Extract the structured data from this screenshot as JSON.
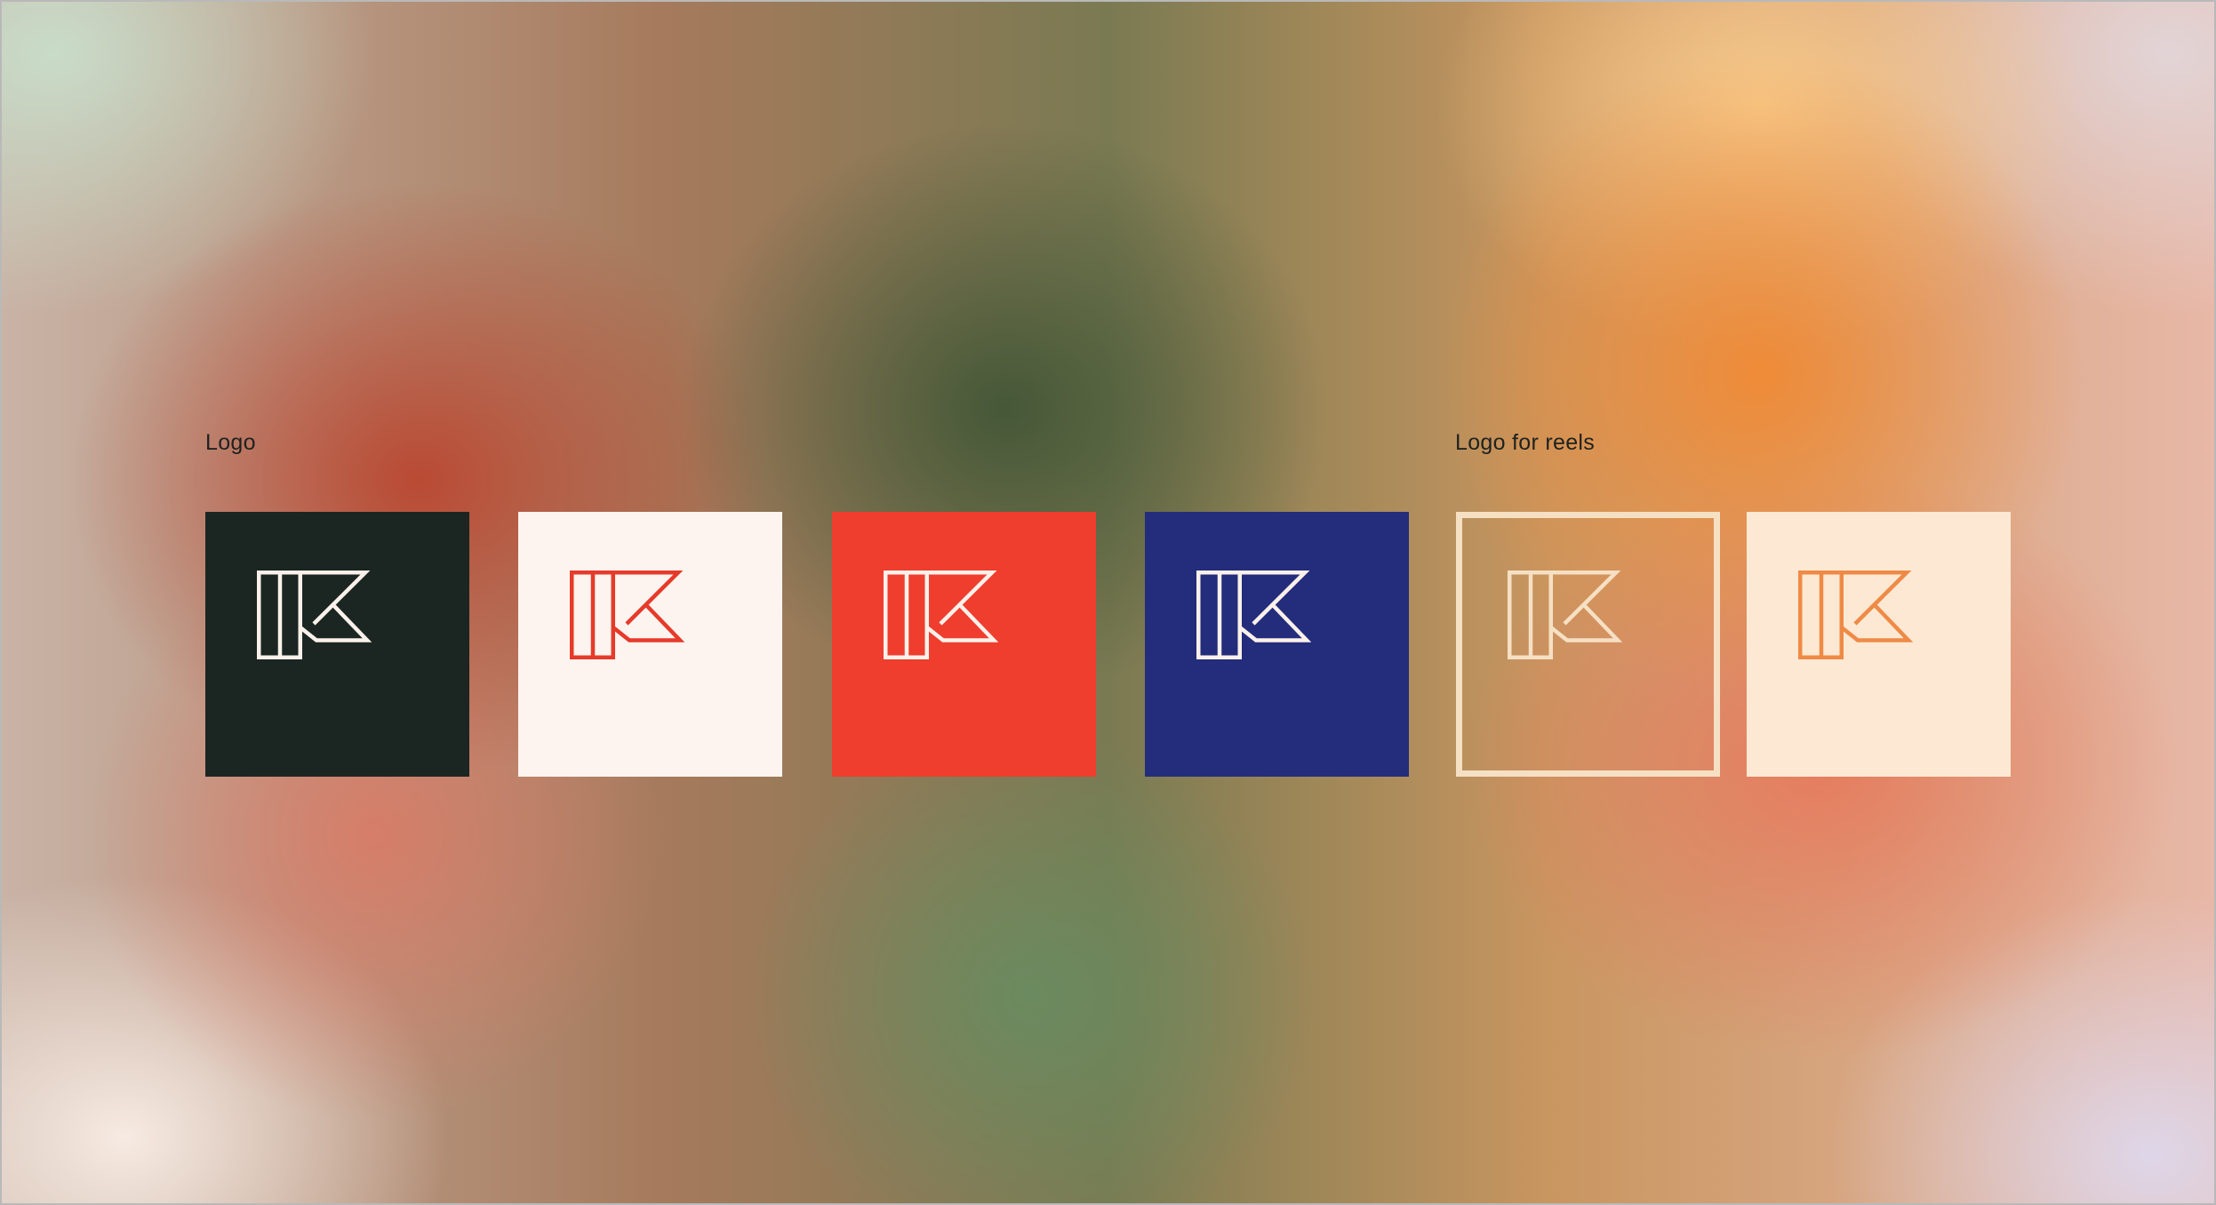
{
  "sections": {
    "logo_label": "Logo",
    "reels_label": "Logo for reels"
  },
  "tiles": [
    {
      "name": "logo-tile-dark",
      "background": "#1b2623",
      "mark_color": "#fbf1ea"
    },
    {
      "name": "logo-tile-light",
      "background": "#fdf4ef",
      "mark_color": "#e63a2a"
    },
    {
      "name": "logo-tile-red",
      "background": "#ef3d2e",
      "mark_color": "#fbf1ea"
    },
    {
      "name": "logo-tile-blue",
      "background": "#242d7c",
      "mark_color": "#fbf1ea"
    },
    {
      "name": "reels-tile-outline",
      "background": "transparent",
      "mark_color": "#f6e0c4",
      "border_color": "#f6e0c4"
    },
    {
      "name": "reels-tile-cream",
      "background": "#fde9d3",
      "mark_color": "#ef8a46"
    }
  ],
  "icon": "k-monogram-icon"
}
